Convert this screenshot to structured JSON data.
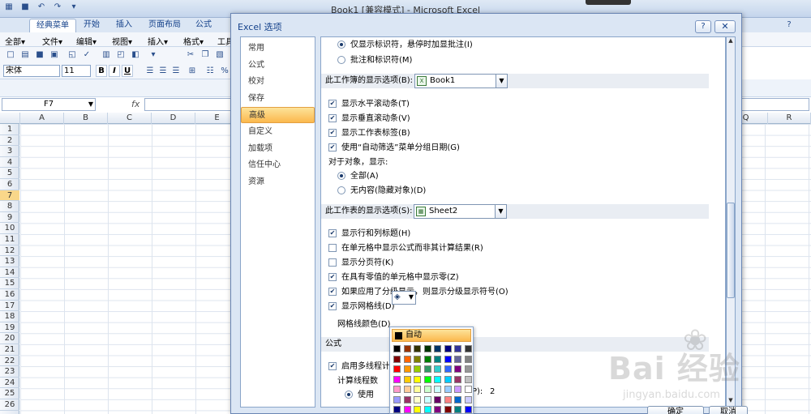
{
  "app": {
    "title": "Book1 [兼容模式] - Microsoft Excel",
    "ribbon_tabs": [
      "经典菜单",
      "开始",
      "插入",
      "页面布局",
      "公式"
    ],
    "active_tab_index": 0,
    "menus": [
      "全部▾",
      "文件▾",
      "编辑▾",
      "视图▾",
      "插入▾",
      "格式▾",
      "工具"
    ],
    "font_name": "宋体",
    "font_size": "11",
    "format_buttons": [
      "B",
      "I",
      "U"
    ],
    "name_box": "F7",
    "fx_label": "fx",
    "columns": [
      "A",
      "B",
      "C",
      "D",
      "E",
      "Q",
      "R"
    ],
    "rows": [
      "1",
      "2",
      "3",
      "4",
      "5",
      "6",
      "7",
      "8",
      "9",
      "10",
      "11",
      "12",
      "13",
      "14",
      "15",
      "16",
      "17",
      "18",
      "19",
      "20",
      "21",
      "22",
      "23",
      "24",
      "25",
      "26"
    ],
    "selected_row": "7"
  },
  "dialog": {
    "title": "Excel 选项",
    "help_label": "?",
    "close_label": "✕",
    "nav": [
      "常用",
      "公式",
      "校对",
      "保存",
      "高级",
      "自定义",
      "加载项",
      "信任中心",
      "资源"
    ],
    "active_nav_index": 4,
    "top_options": [
      {
        "label": "仅显示标识符，悬停时加显批注(I)",
        "checked": true
      },
      {
        "label": "批注和标识符(M)",
        "checked": false
      }
    ],
    "workbook_section": {
      "label": "此工作簿的显示选项(B):",
      "combo_value": "Book1",
      "options": [
        {
          "label": "显示水平滚动条(T)",
          "checked": true
        },
        {
          "label": "显示垂直滚动条(V)",
          "checked": true
        },
        {
          "label": "显示工作表标签(B)",
          "checked": true
        },
        {
          "label": "使用“自动筛选”菜单分组日期(G)",
          "checked": true
        }
      ],
      "objects_label": "对于对象，显示:",
      "object_options": [
        {
          "label": "全部(A)",
          "checked": true
        },
        {
          "label": "无内容(隐藏对象)(D)",
          "checked": false
        }
      ]
    },
    "sheet_section": {
      "label": "此工作表的显示选项(S):",
      "combo_value": "Sheet2",
      "options": [
        {
          "label": "显示行和列标题(H)",
          "checked": true
        },
        {
          "label": "在单元格中显示公式而非其计算结果(R)",
          "checked": false
        },
        {
          "label": "显示分页符(K)",
          "checked": false
        },
        {
          "label": "在具有零值的单元格中显示零(Z)",
          "checked": true
        },
        {
          "label": "如果应用了分级显示，则显示分级显示符号(O)",
          "checked": true
        },
        {
          "label": "显示网格线(D)",
          "checked": true
        }
      ],
      "gridline_color_label": "网格线颜色(D)"
    },
    "formula_section": {
      "label": "公式",
      "multithread_label": "启用多线程计",
      "threads_label": "计算线程数",
      "use_label": "使用",
      "use_suffix": "P):",
      "use_value": "2"
    },
    "color_popup": {
      "auto_label": "自动",
      "colors": [
        [
          "#000000",
          "#993300",
          "#333300",
          "#003300",
          "#003366",
          "#000080",
          "#333399",
          "#333333"
        ],
        [
          "#800000",
          "#FF6600",
          "#808000",
          "#008000",
          "#008080",
          "#0000FF",
          "#666699",
          "#808080"
        ],
        [
          "#FF0000",
          "#FF9900",
          "#99CC00",
          "#339966",
          "#33CCCC",
          "#3366FF",
          "#800080",
          "#969696"
        ],
        [
          "#FF00FF",
          "#FFCC00",
          "#FFFF00",
          "#00FF00",
          "#00FFFF",
          "#00CCFF",
          "#993366",
          "#C0C0C0"
        ],
        [
          "#FF99CC",
          "#FFCC99",
          "#FFFF99",
          "#CCFFCC",
          "#CCFFFF",
          "#99CCFF",
          "#CC99FF",
          "#FFFFFF"
        ],
        [
          "#9999FF",
          "#993366",
          "#FFFFCC",
          "#CCFFFF",
          "#660066",
          "#FF8080",
          "#0066CC",
          "#CCCCFF"
        ],
        [
          "#000080",
          "#FF00FF",
          "#FFFF00",
          "#00FFFF",
          "#800080",
          "#800000",
          "#008080",
          "#0000FF"
        ]
      ]
    },
    "buttons": {
      "ok": "确定",
      "cancel": "取消"
    }
  },
  "watermark": {
    "main": "Bai  经验",
    "sub": "jingyan.baidu.com"
  }
}
